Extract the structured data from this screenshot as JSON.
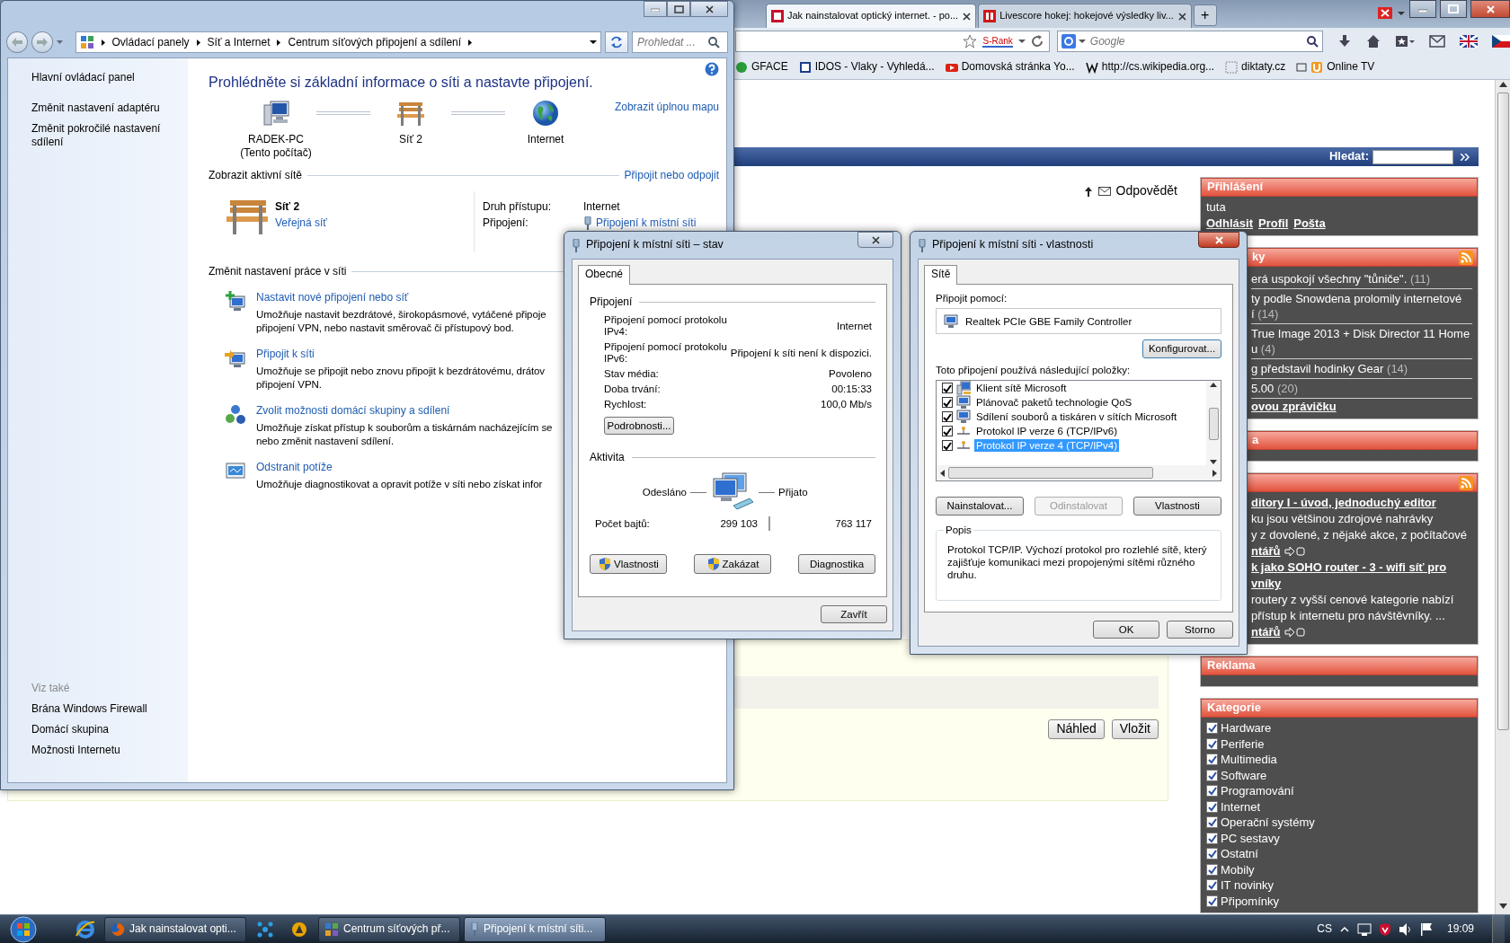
{
  "browser": {
    "tabs": [
      {
        "title": "Jak nainstalovat optický internet. - po...",
        "selected": true
      },
      {
        "title": "Livescore hokej: hokejové výsledky liv...",
        "selected": false
      }
    ],
    "new_tab": "+",
    "rank_label": "S-Rank",
    "search": {
      "placeholder": "Google"
    },
    "bookmarks": [
      "GFACE",
      "IDOS - Vlaky - Vyhledá...",
      "Domovská stránka Yo...",
      "http://cs.wikipedia.org...",
      "diktaty.cz",
      "Online TV"
    ]
  },
  "web_page": {
    "search_label": "Hledat:",
    "reply_link": "Odpovědět",
    "buttons": [
      "Náhled",
      "Vložit"
    ],
    "sidebar": [
      {
        "title": "Přihlášení",
        "rss": false,
        "items": [
          {
            "kind": "text",
            "text": "tuta"
          },
          {
            "kind": "links",
            "links": [
              "Odhlásit",
              "Profil",
              "Pošta"
            ]
          }
        ]
      },
      {
        "title": "ky",
        "rss": true,
        "items": [
          {
            "kind": "entry",
            "lines": [
              "erá uspokojí všechny \"tůniče\"."
            ],
            "count": "(11)"
          },
          {
            "kind": "entry",
            "lines": [
              "ty podle Snowdena prolomily internetové",
              "í"
            ],
            "count": "(14)"
          },
          {
            "kind": "entry",
            "lines": [
              "True Image 2013 + Disk Director 11 Home",
              "u"
            ],
            "count": "(4)"
          },
          {
            "kind": "entry",
            "lines": [
              "g představil hodinky Gear"
            ],
            "count": "(14)"
          },
          {
            "kind": "entry",
            "lines": [
              "5.00"
            ],
            "count": "(20)"
          },
          {
            "kind": "link",
            "text": "ovou zprávičku"
          }
        ]
      },
      {
        "title": "a",
        "rss": false
      },
      {
        "rss": true,
        "items": [
          {
            "kind": "link",
            "text": "ditory I - úvod, jednoduchý editor"
          },
          {
            "kind": "text",
            "text": "ku jsou většinou zdrojové nahrávky"
          },
          {
            "kind": "text",
            "text": "y z dovolené, z nějaké akce, z počítačové"
          },
          {
            "kind": "comments",
            "text": "ntářů"
          },
          {
            "kind": "link",
            "text": "k jako SOHO router - 3 - wifi síť pro"
          },
          {
            "kind": "link",
            "text": "vníky"
          },
          {
            "kind": "text",
            "text": "routery z vyšší cenové kategorie nabízí"
          },
          {
            "kind": "text",
            "text": "přístup k internetu pro návštěvníky. ..."
          },
          {
            "kind": "comments",
            "text": "ntářů"
          }
        ]
      },
      {
        "title": "Reklama",
        "rss": false
      },
      {
        "title": "Kategorie",
        "rss": false,
        "items": [
          {
            "kind": "check",
            "label": "Hardware",
            "checked": true
          },
          {
            "kind": "check",
            "label": "Periferie",
            "checked": true
          },
          {
            "kind": "check",
            "label": "Multimedia",
            "checked": true
          },
          {
            "kind": "check",
            "label": "Software",
            "checked": true
          },
          {
            "kind": "check",
            "label": "Programování",
            "checked": true
          },
          {
            "kind": "check",
            "label": "Internet",
            "checked": true
          },
          {
            "kind": "check",
            "label": "Operační systémy",
            "checked": true
          },
          {
            "kind": "check",
            "label": "PC sestavy",
            "checked": true
          },
          {
            "kind": "check",
            "label": "Ostatní",
            "checked": true
          },
          {
            "kind": "check",
            "label": "Mobily",
            "checked": true
          },
          {
            "kind": "check",
            "label": "IT novinky",
            "checked": true
          },
          {
            "kind": "check",
            "label": "Připomínky",
            "checked": true
          }
        ]
      }
    ]
  },
  "explorer": {
    "breadcrumb": [
      "Ovládací panely",
      "Síť a Internet",
      "Centrum síťových připojení a sdílení"
    ],
    "search": {
      "placeholder": "Prohledat ..."
    },
    "side_links": [
      "Hlavní ovládací panel",
      "Změnit nastavení adaptéru",
      "Změnit pokročilé nastavení sdílení"
    ],
    "see_also_title": "Viz také",
    "see_also": [
      "Brána Windows Firewall",
      "Domácí skupina",
      "Možnosti Internetu"
    ],
    "heading": "Prohlédněte si základní informace o síti a nastavte připojení.",
    "map": {
      "nodes": [
        {
          "kind": "computer",
          "label": "RADEK-PC",
          "sublabel": "(Tento počítač)"
        },
        {
          "kind": "bench",
          "label": "Síť 2"
        },
        {
          "kind": "globe",
          "label": "Internet"
        }
      ],
      "full_map_link": "Zobrazit úplnou mapu"
    },
    "active_title": "Zobrazit aktivní sítě",
    "connect_link": "Připojit nebo odpojit",
    "network": {
      "name": "Síť 2",
      "type": "Veřejná síť",
      "access_label": "Druh přístupu:",
      "access_value": "Internet",
      "connection_label": "Připojení:",
      "connection_value": "Připojení k místní síti"
    },
    "tasks_title": "Změnit nastavení práce v síti",
    "tasks": [
      {
        "title": "Nastavit nové připojení nebo síť",
        "description": [
          "Umožňuje nastavit bezdrátové, širokopásmové, vytáčené připoje",
          "připojení VPN, nebo nastavit směrovač či přístupový bod."
        ]
      },
      {
        "title": "Připojit k síti",
        "description": [
          "Umožňuje se připojit nebo znovu připojit k bezdrátovému, drátov",
          "připojení VPN."
        ]
      },
      {
        "title": "Zvolit možnosti domácí skupiny a sdílení",
        "description": [
          "Umožňuje získat přístup k souborům a tiskárnám nacházejícím se",
          "nebo změnit nastavení sdílení."
        ]
      },
      {
        "title": "Odstranit potíže",
        "description": [
          "Umožňuje diagnostikovat a opravit potíže v síti nebo získat infor"
        ]
      }
    ]
  },
  "status_dialog": {
    "title": "Připojení k místní síti – stav",
    "tabs": [
      {
        "label": "Obecné",
        "selected": true
      }
    ],
    "connection_group": "Připojení",
    "rows": [
      {
        "label": "Připojení pomocí protokolu IPv4:",
        "value": "Internet"
      },
      {
        "label": "Připojení pomocí protokolu IPv6:",
        "value": "Připojení k síti není k dispozici."
      },
      {
        "label": "Stav média:",
        "value": "Povoleno"
      },
      {
        "label": "Doba trvání:",
        "value": "00:15:33"
      },
      {
        "label": "Rychlost:",
        "value": "100,0 Mb/s"
      }
    ],
    "details_button": "Podrobnosti...",
    "activity_group": "Aktivita",
    "sent_label": "Odesláno",
    "received_label": "Přijato",
    "bytes_label": "Počet bajtů:",
    "sent": "299 103",
    "received": "763 117",
    "buttons": [
      {
        "label": "Vlastnosti",
        "shield": true
      },
      {
        "label": "Zakázat",
        "shield": true
      },
      {
        "label": "Diagnostika",
        "shield": false
      }
    ],
    "close_button": "Zavřít"
  },
  "properties_dialog": {
    "title": "Připojení k místní síti - vlastnosti",
    "tabs": [
      {
        "label": "Sítě",
        "selected": true
      }
    ],
    "connect_using_label": "Připojit pomocí:",
    "adapter": "Realtek PCIe GBE Family Controller",
    "configure_button": "Konfigurovat...",
    "items_label": "Toto připojení používá následující položky:",
    "items": [
      {
        "kind": "client",
        "label": "Klient sítě Microsoft",
        "checked": true,
        "selected": false
      },
      {
        "kind": "service",
        "label": "Plánovač paketů technologie QoS",
        "checked": true,
        "selected": false
      },
      {
        "kind": "service",
        "label": "Sdílení souborů a tiskáren v sítích Microsoft",
        "checked": true,
        "selected": false
      },
      {
        "kind": "protocol",
        "label": "Protokol IP verze 6 (TCP/IPv6)",
        "checked": true,
        "selected": false
      },
      {
        "kind": "protocol",
        "label": "Protokol IP verze 4 (TCP/IPv4)",
        "checked": true,
        "selected": true
      }
    ],
    "buttons": [
      {
        "label": "Nainstalovat...",
        "disabled": false
      },
      {
        "label": "Odinstalovat",
        "disabled": true
      },
      {
        "label": "Vlastnosti",
        "disabled": false
      }
    ],
    "description_group": "Popis",
    "description": "Protokol TCP/IP. Výchozí protokol pro rozlehlé sítě, který zajišťuje komunikaci mezi propojenými sítěmi různého druhu.",
    "ok_button": "OK",
    "cancel_button": "Storno"
  },
  "taskbar": {
    "buttons": [
      {
        "label": "Jak nainstalovat opti...",
        "selected": false
      },
      {
        "label": "Centrum síťových př...",
        "selected": false
      },
      {
        "label": "Připojení k místní síti...",
        "selected": true
      }
    ],
    "language": "CS",
    "clock": "19:09"
  }
}
